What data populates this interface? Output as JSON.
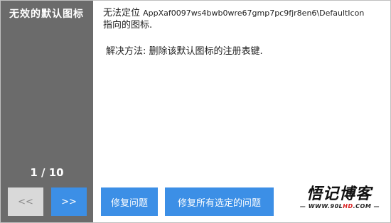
{
  "sidebar": {
    "title": "无效的默认图标",
    "page_counter": "1 / 10",
    "prev_label": "<<",
    "next_label": ">>"
  },
  "message": {
    "prefix": "无法定位",
    "path": "AppXaf0097ws4bwb0wre67gmp7pc9fjr8en6\\DefaultIcon",
    "suffix": "指向的图标."
  },
  "solution": "解决方法: 删除该默认图标的注册表键.",
  "actions": {
    "fix_label": "修复问题",
    "fix_all_label": "修复所有选定的问题"
  },
  "watermark": {
    "title": "悟记博客",
    "url_prefix": "— WWW.90L",
    "url_highlight": "HD",
    "url_suffix": ".COM —"
  }
}
